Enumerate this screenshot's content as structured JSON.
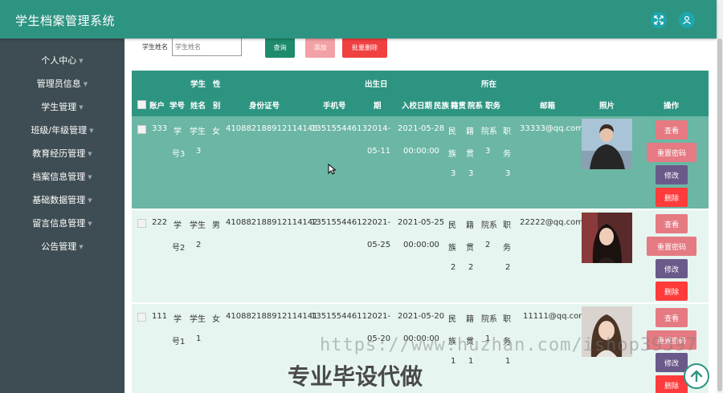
{
  "header": {
    "title": "学生档案管理系统"
  },
  "sidebar": {
    "items": [
      "个人中心",
      "管理员信息",
      "学生管理",
      "班级/年级管理",
      "教育经历管理",
      "档案信息管理",
      "基础数据管理",
      "留言信息管理",
      "公告管理"
    ]
  },
  "search": {
    "label": "学生姓名",
    "placeholder": "学生姓名",
    "query_label": "查询",
    "add_label": "添加",
    "batch_delete_label": "批量删除"
  },
  "table": {
    "headers": {
      "account": "账户",
      "student_no": "学号",
      "name_top": "学生",
      "name_bottom": "姓名",
      "gender_top": "性",
      "gender_bottom": "别",
      "id_card": "身份证号",
      "phone": "手机号",
      "birth_top": "出生日",
      "birth_bottom": "期",
      "enroll": "入校日期",
      "ethnic": "民族",
      "hometown_top": "所在",
      "hometown_bottom": "籍贯",
      "dept": "院系",
      "position": "职务",
      "email": "邮箱",
      "photo": "照片",
      "actions": "操作"
    },
    "rows": [
      {
        "account": "333",
        "no_a": "学",
        "no_b": "号3",
        "name_a": "学生",
        "name_b": "3",
        "gender": "女",
        "id_card": "410882188912114143",
        "phone": "13515544613",
        "birth_a": "2014-",
        "birth_b": "05-11",
        "enroll_a": "2021-05-28",
        "enroll_b": "00:00:00",
        "eth_a": "民",
        "eth_b": "族",
        "eth_c": "3",
        "home_a": "籍",
        "home_b": "贯",
        "home_c": "3",
        "dept_a": "院系",
        "dept_b": "3",
        "pos_a": "职",
        "pos_b": "务",
        "pos_c": "3",
        "email": "33333@qq.com"
      },
      {
        "account": "222",
        "no_a": "学",
        "no_b": "号2",
        "name_a": "学生",
        "name_b": "2",
        "gender": "男",
        "id_card": "410882188912114142",
        "phone": "13515544612",
        "birth_a": "2021-",
        "birth_b": "05-25",
        "enroll_a": "2021-05-25",
        "enroll_b": "00:00:00",
        "eth_a": "民",
        "eth_b": "族",
        "eth_c": "2",
        "home_a": "籍",
        "home_b": "贯",
        "home_c": "2",
        "dept_a": "院系",
        "dept_b": "2",
        "pos_a": "职",
        "pos_b": "务",
        "pos_c": "2",
        "email": "22222@qq.com"
      },
      {
        "account": "111",
        "no_a": "学",
        "no_b": "号1",
        "name_a": "学生",
        "name_b": "1",
        "gender": "女",
        "id_card": "410882188912114141",
        "phone": "13515544611",
        "birth_a": "2021-",
        "birth_b": "05-20",
        "enroll_a": "2021-05-20",
        "enroll_b": "00:00:00",
        "eth_a": "民",
        "eth_b": "族",
        "eth_c": "1",
        "home_a": "籍",
        "home_b": "贯",
        "home_c": "1",
        "dept_a": "院系",
        "dept_b": "1",
        "pos_a": "职",
        "pos_b": "务",
        "pos_c": "1",
        "email": "11111@qq.com"
      }
    ],
    "actions": {
      "view": "查看",
      "reset": "重置密码",
      "edit": "修改",
      "delete": "删除"
    }
  },
  "watermark": {
    "url": "https://www.huzhan.com/ishop39397",
    "text": "专业毕设代做"
  },
  "colors": {
    "header": "#2e9482",
    "sidebar": "#3e4d53",
    "row_selected": "#6bb6a4",
    "row_light": "#e6f5ef",
    "view_btn": "#e57a82",
    "edit_btn": "#6a5a8a",
    "delete_btn": "#ff3b3b",
    "query_btn": "#1e8c6c",
    "batch_btn": "#f04040"
  }
}
